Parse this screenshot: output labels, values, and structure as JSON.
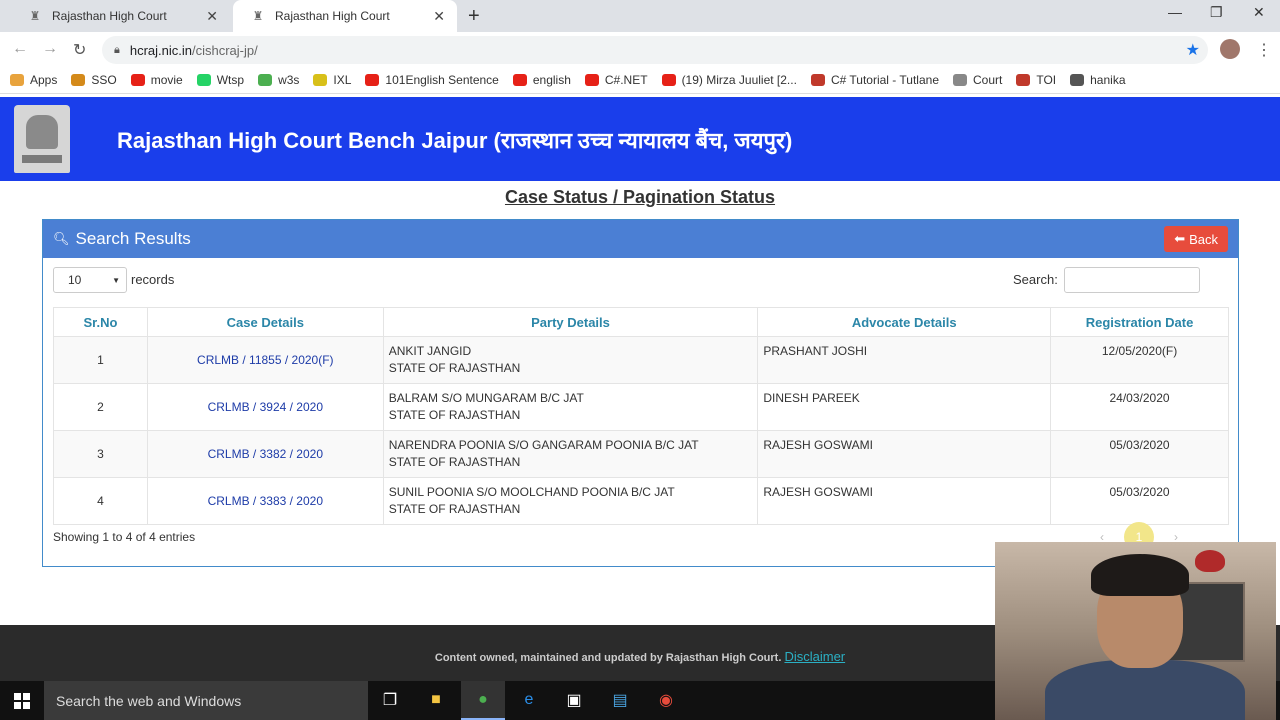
{
  "browser": {
    "tabs": [
      {
        "title": "Rajasthan High Court",
        "active": false
      },
      {
        "title": "Rajasthan High Court",
        "active": true
      }
    ],
    "url_host": "hcraj.nic.in",
    "url_path": "/cishcraj-jp/",
    "bookmarks": [
      {
        "label": "Apps",
        "icon": "apps-grid-icon",
        "color": "#e8a33d"
      },
      {
        "label": "SSO",
        "icon": "sso-icon",
        "color": "#d48a1a"
      },
      {
        "label": "movie",
        "icon": "youtube-icon",
        "color": "#e62117"
      },
      {
        "label": "Wtsp",
        "icon": "whatsapp-icon",
        "color": "#25d366"
      },
      {
        "label": "w3s",
        "icon": "w3schools-icon",
        "color": "#4caf50"
      },
      {
        "label": "IXL",
        "icon": "ixl-icon",
        "color": "#d8c01a"
      },
      {
        "label": "101English Sentence",
        "icon": "youtube-icon",
        "color": "#e62117"
      },
      {
        "label": "english",
        "icon": "youtube-icon",
        "color": "#e62117"
      },
      {
        "label": "C#.NET",
        "icon": "youtube-icon",
        "color": "#e62117"
      },
      {
        "label": "(19) Mirza Juuliet [2...",
        "icon": "youtube-icon",
        "color": "#e62117"
      },
      {
        "label": "C# Tutorial - Tutlane",
        "icon": "tutlane-icon",
        "color": "#c0392b"
      },
      {
        "label": "Court",
        "icon": "court-icon",
        "color": "#888888"
      },
      {
        "label": "TOI",
        "icon": "toi-icon",
        "color": "#c0392b"
      },
      {
        "label": "hanika",
        "icon": "globe-icon",
        "color": "#555555"
      }
    ]
  },
  "site": {
    "title": "Rajasthan High Court Bench Jaipur (राजस्थान उच्च न्यायालय बैंच, जयपुर)",
    "page_title": "Case Status / Pagination Status",
    "header_color": "#1a3eeb"
  },
  "panel": {
    "heading": "Search Results",
    "back_label": "Back",
    "page_length": "10",
    "records_label": "records",
    "search_label": "Search:",
    "columns": [
      "Sr.No",
      "Case Details",
      "Party Details",
      "Advocate Details",
      "Registration Date"
    ],
    "rows": [
      {
        "sr": "1",
        "case": "CRLMB / 11855 / 2020(F)",
        "party1": "ANKIT JANGID",
        "party2": "STATE OF RAJASTHAN",
        "advocate": "PRASHANT JOSHI",
        "date": "12/05/2020(F)"
      },
      {
        "sr": "2",
        "case": "CRLMB / 3924 / 2020",
        "party1": "BALRAM S/O MUNGARAM B/C JAT",
        "party2": "STATE OF RAJASTHAN",
        "advocate": "DINESH PAREEK",
        "date": "24/03/2020"
      },
      {
        "sr": "3",
        "case": "CRLMB / 3382 / 2020",
        "party1": "NARENDRA POONIA S/O GANGARAM POONIA B/C JAT",
        "party2": "STATE OF RAJASTHAN",
        "advocate": "RAJESH GOSWAMI",
        "date": "05/03/2020"
      },
      {
        "sr": "4",
        "case": "CRLMB / 3383 / 2020",
        "party1": "SUNIL POONIA S/O MOOLCHAND POONIA B/C JAT",
        "party2": "STATE OF RAJASTHAN",
        "advocate": "RAJESH GOSWAMI",
        "date": "05/03/2020"
      }
    ],
    "showing": "Showing 1 to 4 of 4 entries",
    "current_page": "1"
  },
  "footer": {
    "text": "Content owned, maintained and updated by Rajasthan High Court.",
    "link": "Disclaimer"
  },
  "taskbar": {
    "search_placeholder": "Search the web and Windows"
  }
}
